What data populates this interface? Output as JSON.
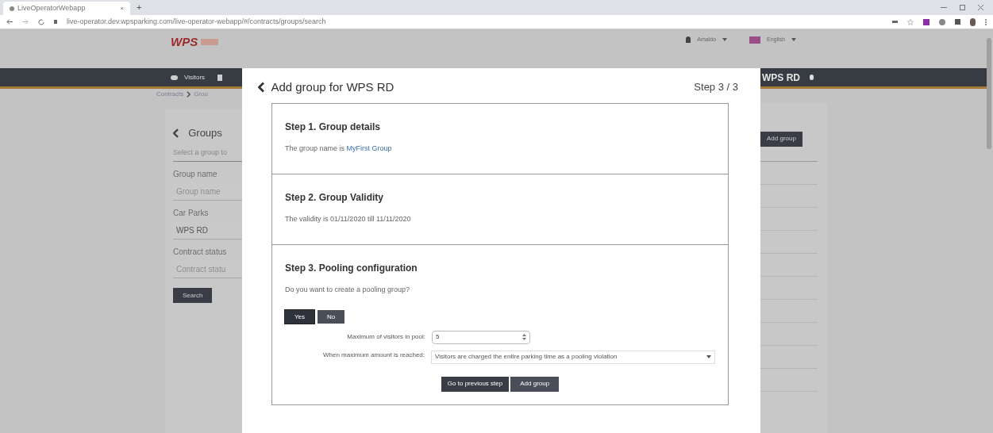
{
  "browser": {
    "tab_title": "LiveOperatorWebapp",
    "tab_close": "×",
    "new_tab": "+",
    "url": "live-operator.dev.wpsparking.com/live-operator-webapp/#/contracts/groups/search"
  },
  "header": {
    "logo_text": "WPS",
    "user": "Amaldo",
    "language": "English"
  },
  "nav": {
    "items": [
      {
        "label": "Visitors"
      }
    ],
    "car_park": "WPS RD"
  },
  "breadcrumb": [
    "Contracts",
    "Grou"
  ],
  "filters": {
    "title": "Groups",
    "subtitle": "Select a group to",
    "fields": [
      {
        "label": "Group name",
        "placeholder": "Group name"
      },
      {
        "label": "Car Parks",
        "value": "WPS RD"
      },
      {
        "label": "Contract status",
        "placeholder": "Contract statu"
      }
    ],
    "search_button": "Search"
  },
  "right_panel": {
    "add_button": "Add group"
  },
  "modal": {
    "title": "Add group for WPS RD",
    "step_indicator": "Step 3 / 3",
    "steps": [
      {
        "title": "Step 1. Group details",
        "text": "The group name is **MyFirst Group**"
      },
      {
        "title": "Step 2. Group Validity",
        "text": "The validity is 01/11/2020 till 11/11/2020"
      },
      {
        "title": "Step 3. Pooling configuration",
        "text": "Do you want to create a pooling group?"
      }
    ],
    "choices": [
      {
        "label": "Yes",
        "selected": true
      },
      {
        "label": "No",
        "selected": false
      }
    ],
    "max_label": "Maximum of visitors in pool:",
    "max_value": "5",
    "when_label": "When maximum amount is reached:",
    "when_value": "Visitors are charged the entire parking time as a pooling violation",
    "buttons": [
      "Go to previous step",
      "Add group"
    ]
  }
}
